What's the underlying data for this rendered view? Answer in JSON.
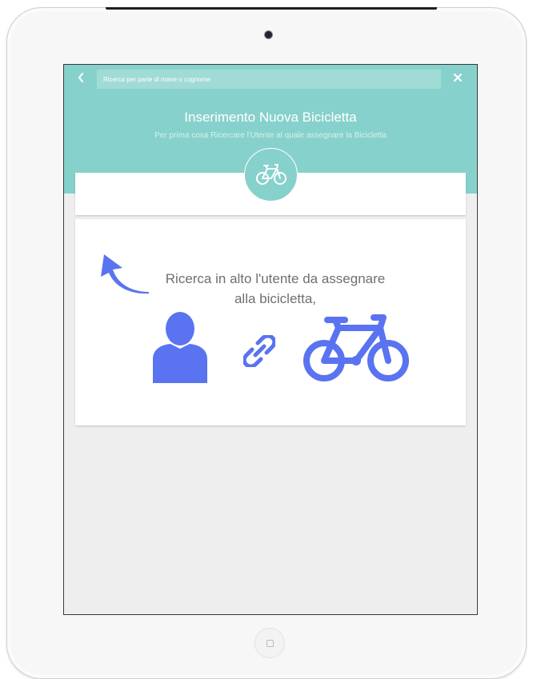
{
  "header": {
    "back_icon": "chevron-left-icon",
    "search_placeholder": "Ricerca per parte di nome o cognome",
    "close_icon": "close-icon",
    "title": "Inserimento Nuova Bicicletta",
    "subtitle": "Per prima cosa Ricercare l'Utente al quale assegnare la Bicicletta",
    "badge_icon": "bicycle-icon"
  },
  "main": {
    "instruction_line1": "Ricerca in alto l'utente da assegnare",
    "instruction_line2": "alla bicicletta,",
    "icons": [
      "arrow-up-left-icon",
      "user-icon",
      "link-icon",
      "bicycle-icon"
    ]
  },
  "colors": {
    "accent": "#87d1cc",
    "illustration": "#5a73f0",
    "text": "#6f6f6f"
  }
}
